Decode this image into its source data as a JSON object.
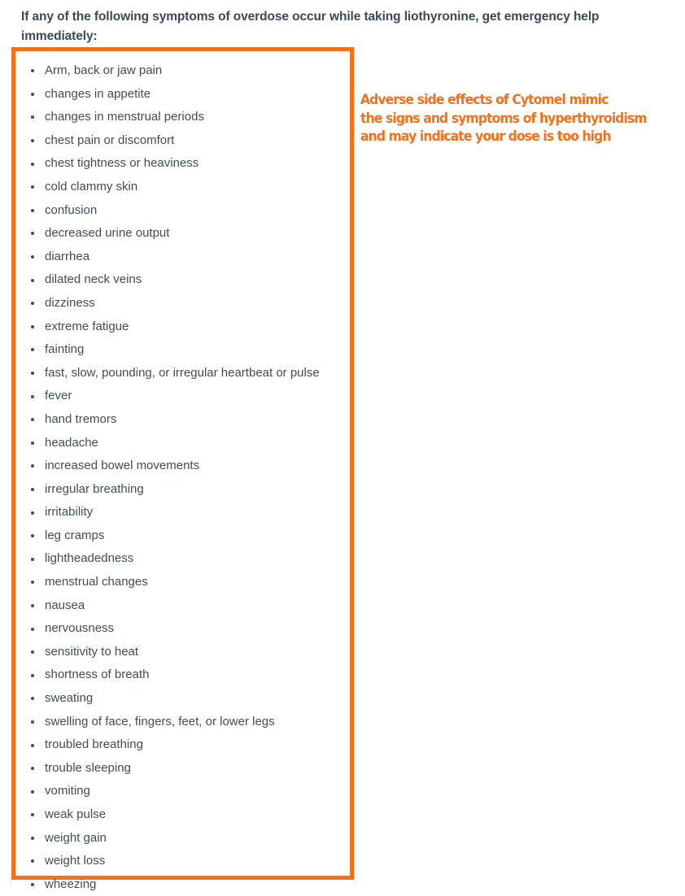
{
  "page": {
    "background_color": "#ffffff",
    "accent_color": "#F4701B",
    "text_color": "#414c57",
    "heading_color": "#3d4852"
  },
  "heading": {
    "text": "If any of the following symptoms of overdose occur while taking liothyronine, get emergency help immediately:"
  },
  "symptom_box": {
    "border_color": "#F4701B",
    "items": [
      "Arm, back or jaw pain",
      "changes in appetite",
      "changes in menstrual periods",
      "chest pain or discomfort",
      "chest tightness or heaviness",
      "cold clammy skin",
      "confusion",
      "decreased urine output",
      "diarrhea",
      "dilated neck veins",
      "dizziness",
      "extreme fatigue",
      "fainting",
      "fast, slow, pounding, or irregular heartbeat or pulse",
      "fever",
      "hand tremors",
      "headache",
      "increased bowel movements",
      "irregular breathing",
      "irritability",
      "leg cramps",
      "lightheadedness",
      "menstrual changes",
      "nausea",
      "nervousness",
      "sensitivity to heat",
      "shortness of breath",
      "sweating",
      "swelling of face, fingers, feet, or lower legs",
      "troubled breathing",
      "trouble sleeping",
      "vomiting",
      "weak pulse",
      "weight gain",
      "weight loss",
      "wheezing"
    ]
  },
  "annotation": {
    "color": "#F4701B",
    "lines": [
      "Adverse side effects of Cytomel mimic",
      "the signs and symptoms of hyperthyroidism",
      "and may indicate your dose is too high"
    ]
  }
}
